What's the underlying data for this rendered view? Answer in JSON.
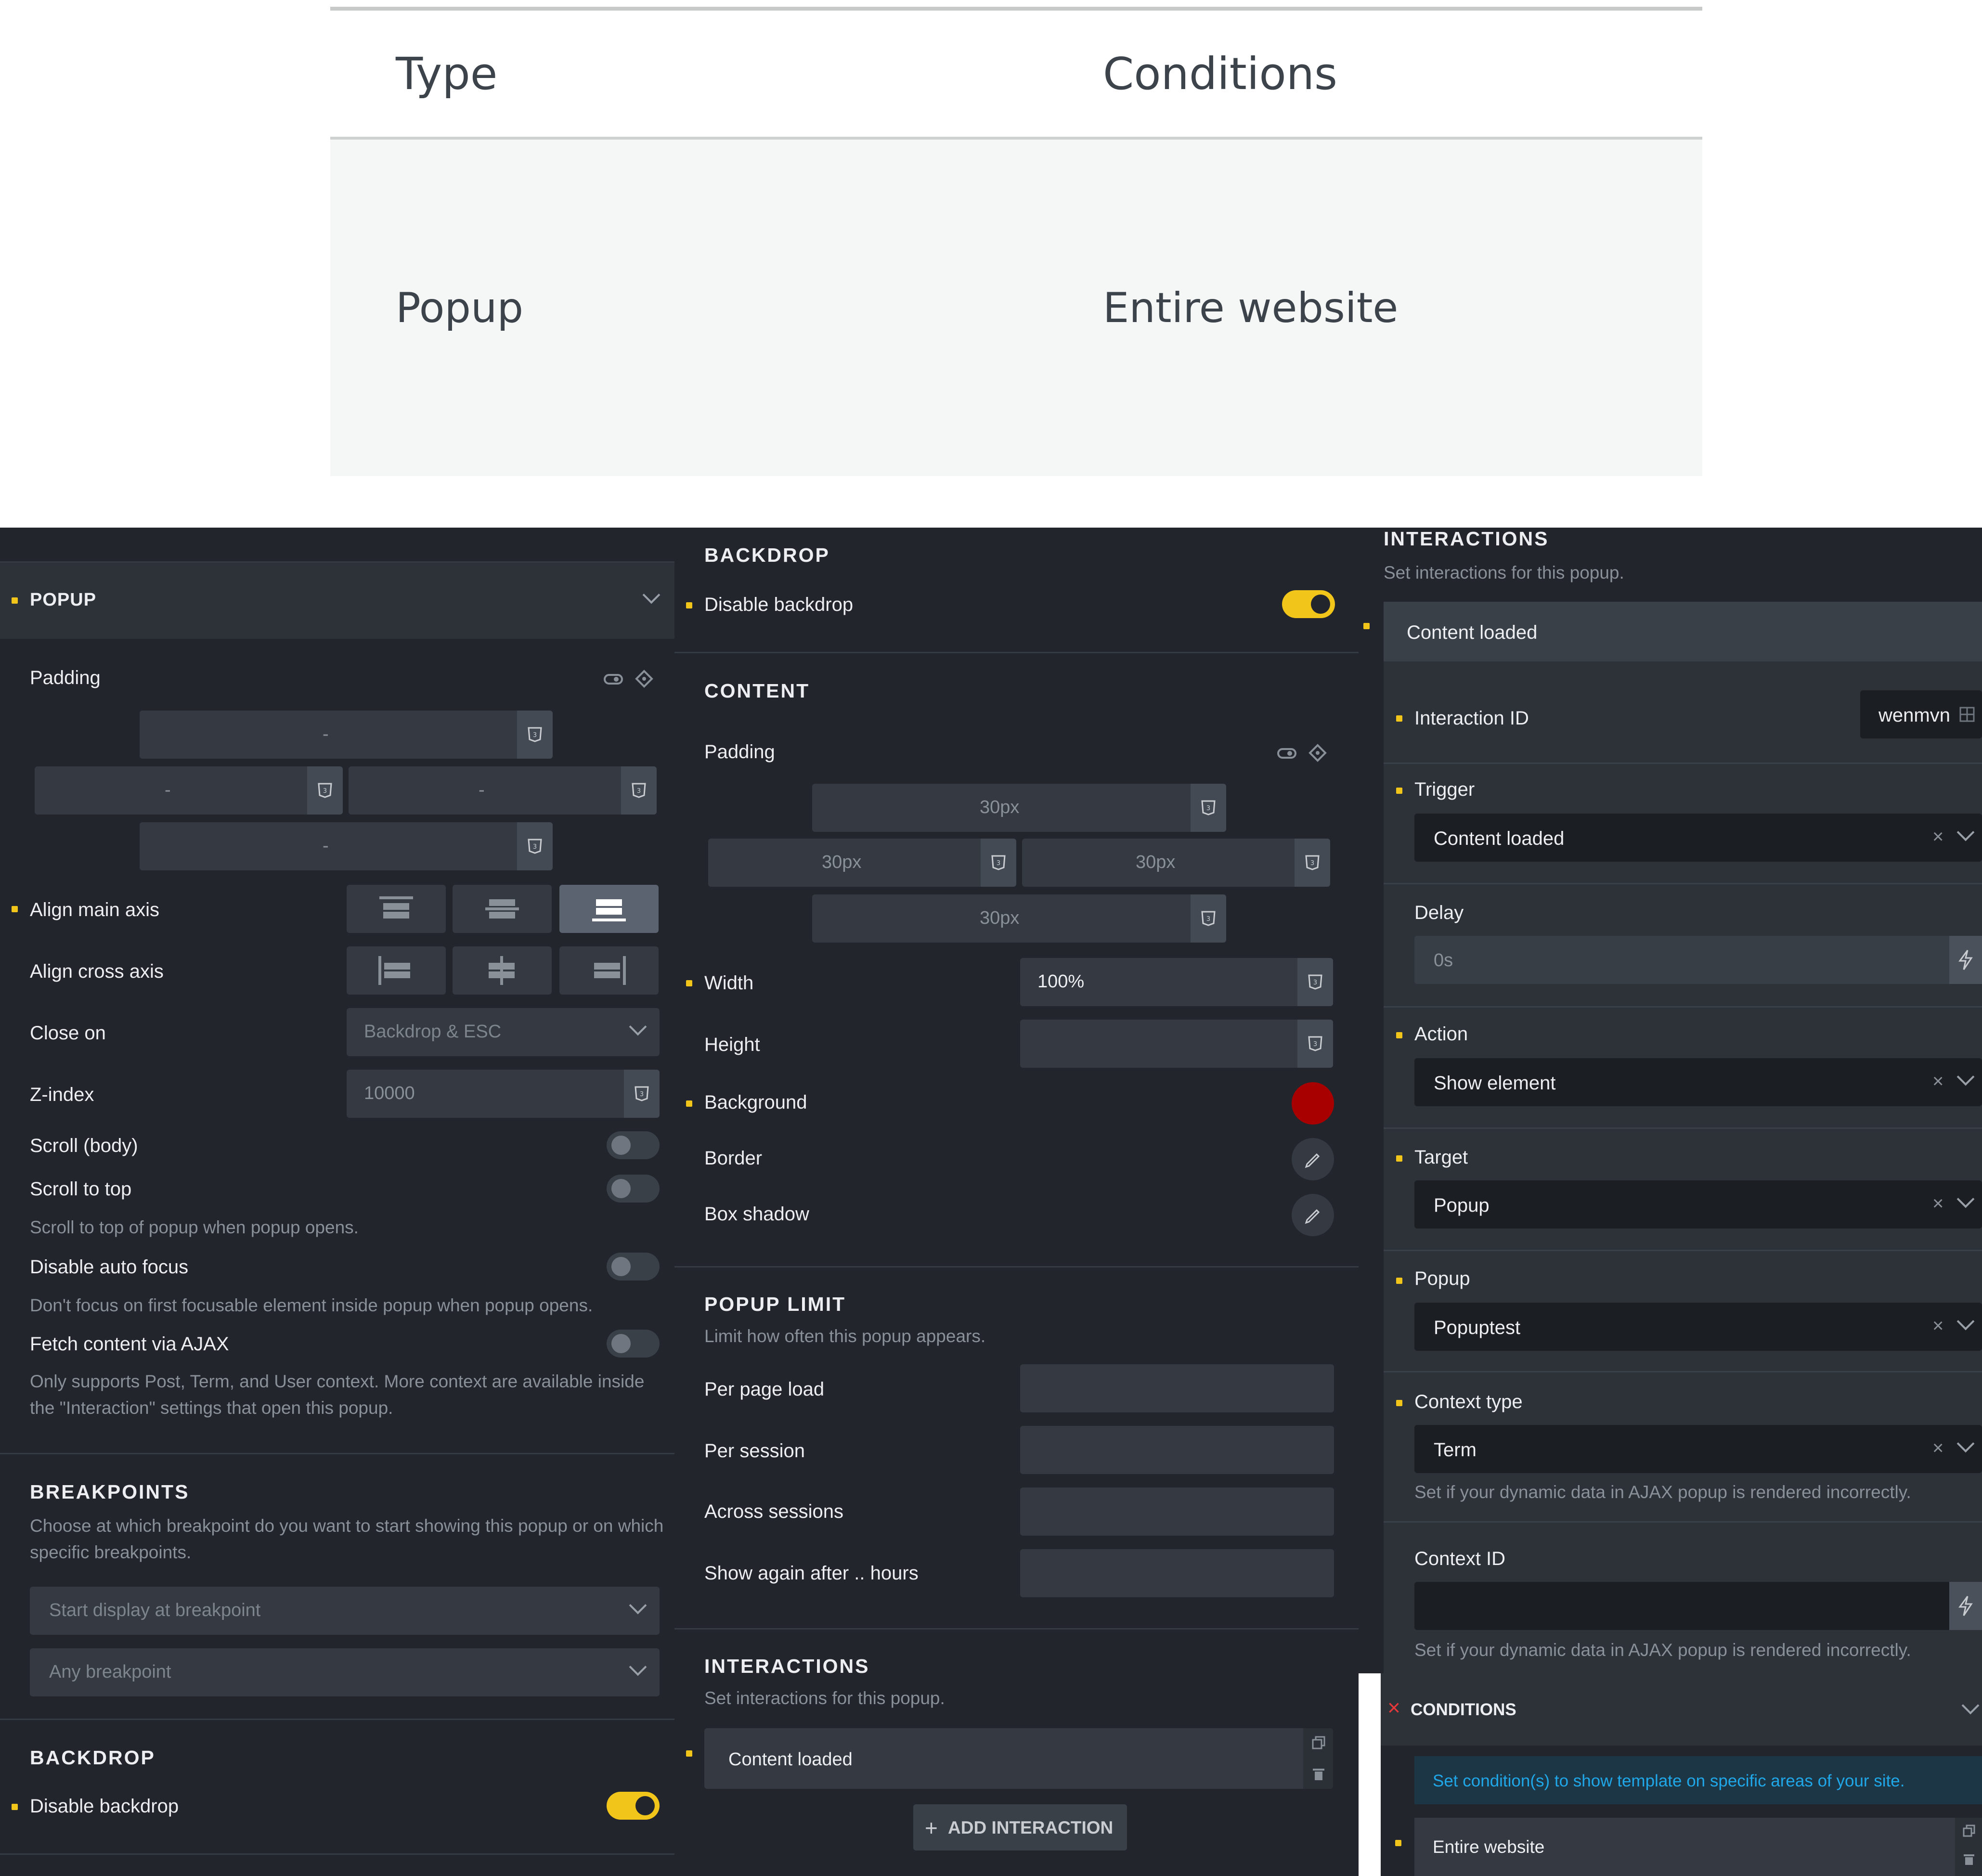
{
  "table": {
    "headers": [
      "Type",
      "Conditions"
    ],
    "rows": [
      [
        "Popup",
        "Entire website"
      ]
    ]
  },
  "left": {
    "popup_header": "POPUP",
    "padding_label": "Padding",
    "padding_values": [
      "-",
      "-",
      "-",
      "-"
    ],
    "align_main_label": "Align main axis",
    "align_cross_label": "Align cross axis",
    "close_on_label": "Close on",
    "close_on_value": "Backdrop & ESC",
    "z_index_label": "Z-index",
    "z_index_placeholder": "10000",
    "scroll_body_label": "Scroll (body)",
    "scroll_top_label": "Scroll to top",
    "scroll_top_desc": "Scroll to top of popup when popup opens.",
    "disable_focus_label": "Disable auto focus",
    "disable_focus_desc": "Don't focus on first focusable element inside popup when popup opens.",
    "fetch_ajax_label": "Fetch content via AJAX",
    "fetch_ajax_desc": "Only supports Post, Term, and User context. More context are available inside the \"Interaction\" settings that open this popup.",
    "breakpoints_header": "BREAKPOINTS",
    "breakpoints_desc": "Choose at which breakpoint do you want to start showing this popup or on which specific breakpoints.",
    "start_display_placeholder": "Start display at breakpoint",
    "any_breakpoint_placeholder": "Any breakpoint",
    "backdrop_header": "BACKDROP",
    "disable_backdrop_label": "Disable backdrop"
  },
  "mid": {
    "backdrop_header": "BACKDROP",
    "disable_backdrop_label": "Disable backdrop",
    "content_header": "CONTENT",
    "padding_label": "Padding",
    "padding_values": [
      "30px",
      "30px",
      "30px",
      "30px"
    ],
    "width_label": "Width",
    "width_value": "100%",
    "height_label": "Height",
    "background_label": "Background",
    "background_color": "#a80000",
    "border_label": "Border",
    "box_shadow_label": "Box shadow",
    "popup_limit_header": "POPUP LIMIT",
    "popup_limit_desc": "Limit how often this popup appears.",
    "per_page_load_label": "Per page load",
    "per_session_label": "Per session",
    "across_sessions_label": "Across sessions",
    "show_again_label": "Show again after .. hours",
    "interactions_header": "INTERACTIONS",
    "interactions_desc": "Set interactions for this popup.",
    "interaction_item": "Content loaded",
    "add_interaction": "ADD INTERACTION"
  },
  "right": {
    "interactions_header": "INTERACTIONS",
    "interactions_desc": "Set interactions for this popup.",
    "interaction_item": "Content loaded",
    "interaction_id_label": "Interaction ID",
    "interaction_id_value": "wenmvn",
    "trigger_label": "Trigger",
    "trigger_value": "Content loaded",
    "delay_label": "Delay",
    "delay_placeholder": "0s",
    "action_label": "Action",
    "action_value": "Show element",
    "target_label": "Target",
    "target_value": "Popup",
    "popup_label": "Popup",
    "popup_value": "Popuptest",
    "context_type_label": "Context type",
    "context_type_value": "Term",
    "context_type_desc": "Set if your dynamic data in AJAX popup is rendered incorrectly.",
    "context_id_label": "Context ID",
    "context_id_desc": "Set if your dynamic data in AJAX popup is rendered incorrectly.",
    "conditions_header": "CONDITIONS",
    "conditions_info": "Set condition(s) to show template on specific areas of your site.",
    "condition_item": "Entire website"
  },
  "colors": {
    "panel_bg": "#22262c",
    "accent_yellow": "#f2c51a",
    "info_blue": "#1fa7e8",
    "close_red": "#e5383b"
  }
}
